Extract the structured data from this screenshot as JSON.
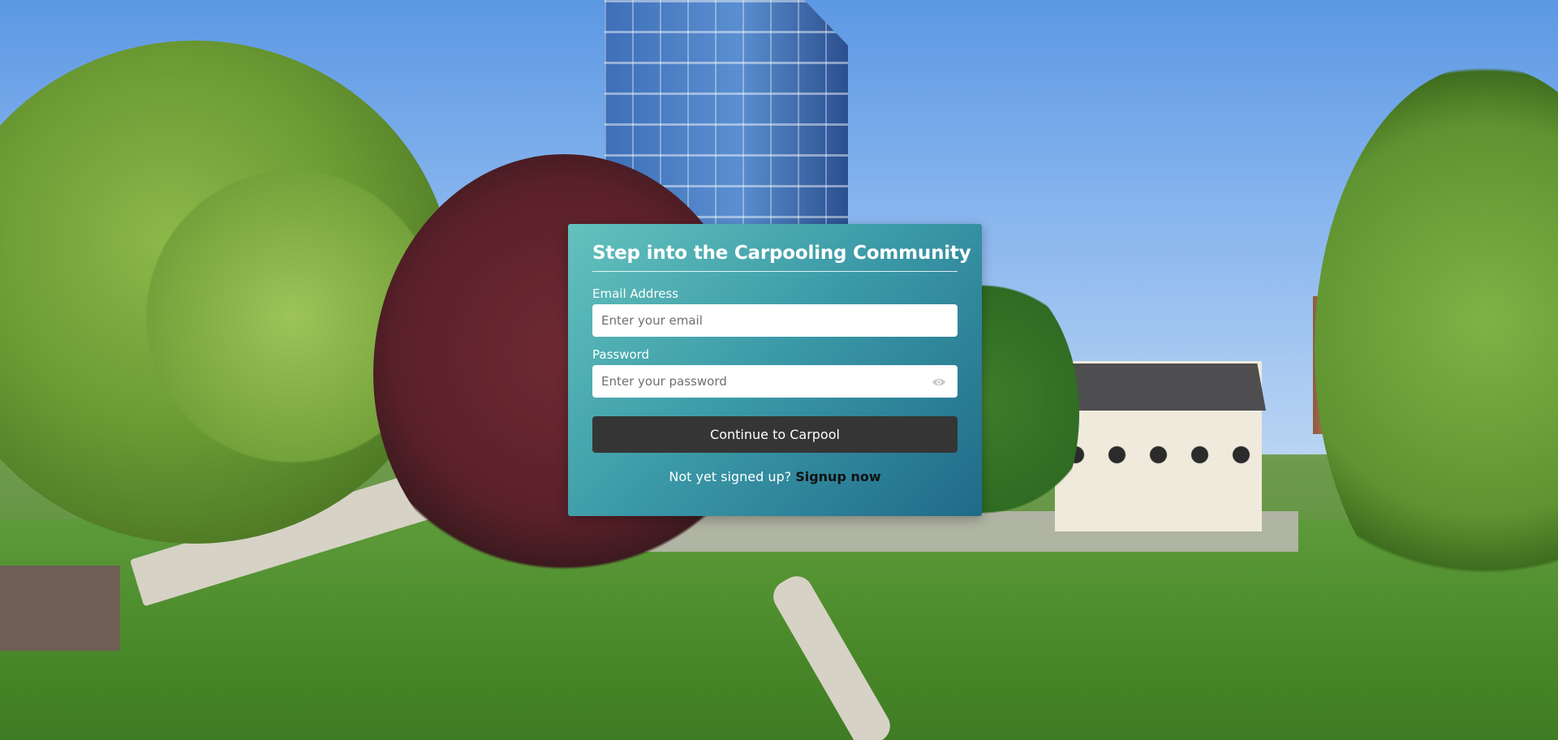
{
  "login": {
    "title": "Step into the Carpooling Community",
    "email_label": "Email Address",
    "email_placeholder": "Enter your email",
    "email_value": "",
    "password_label": "Password",
    "password_placeholder": "Enter your password",
    "password_value": "",
    "password_toggle_icon": "eye-icon",
    "submit_label": "Continue to Carpool",
    "signup_prompt": "Not yet signed up?",
    "signup_link": "Signup now"
  },
  "colors": {
    "card_gradient_start": "#63c2bd",
    "card_gradient_end": "#206a8a",
    "button_bg": "#353535",
    "link_color": "#111111"
  }
}
